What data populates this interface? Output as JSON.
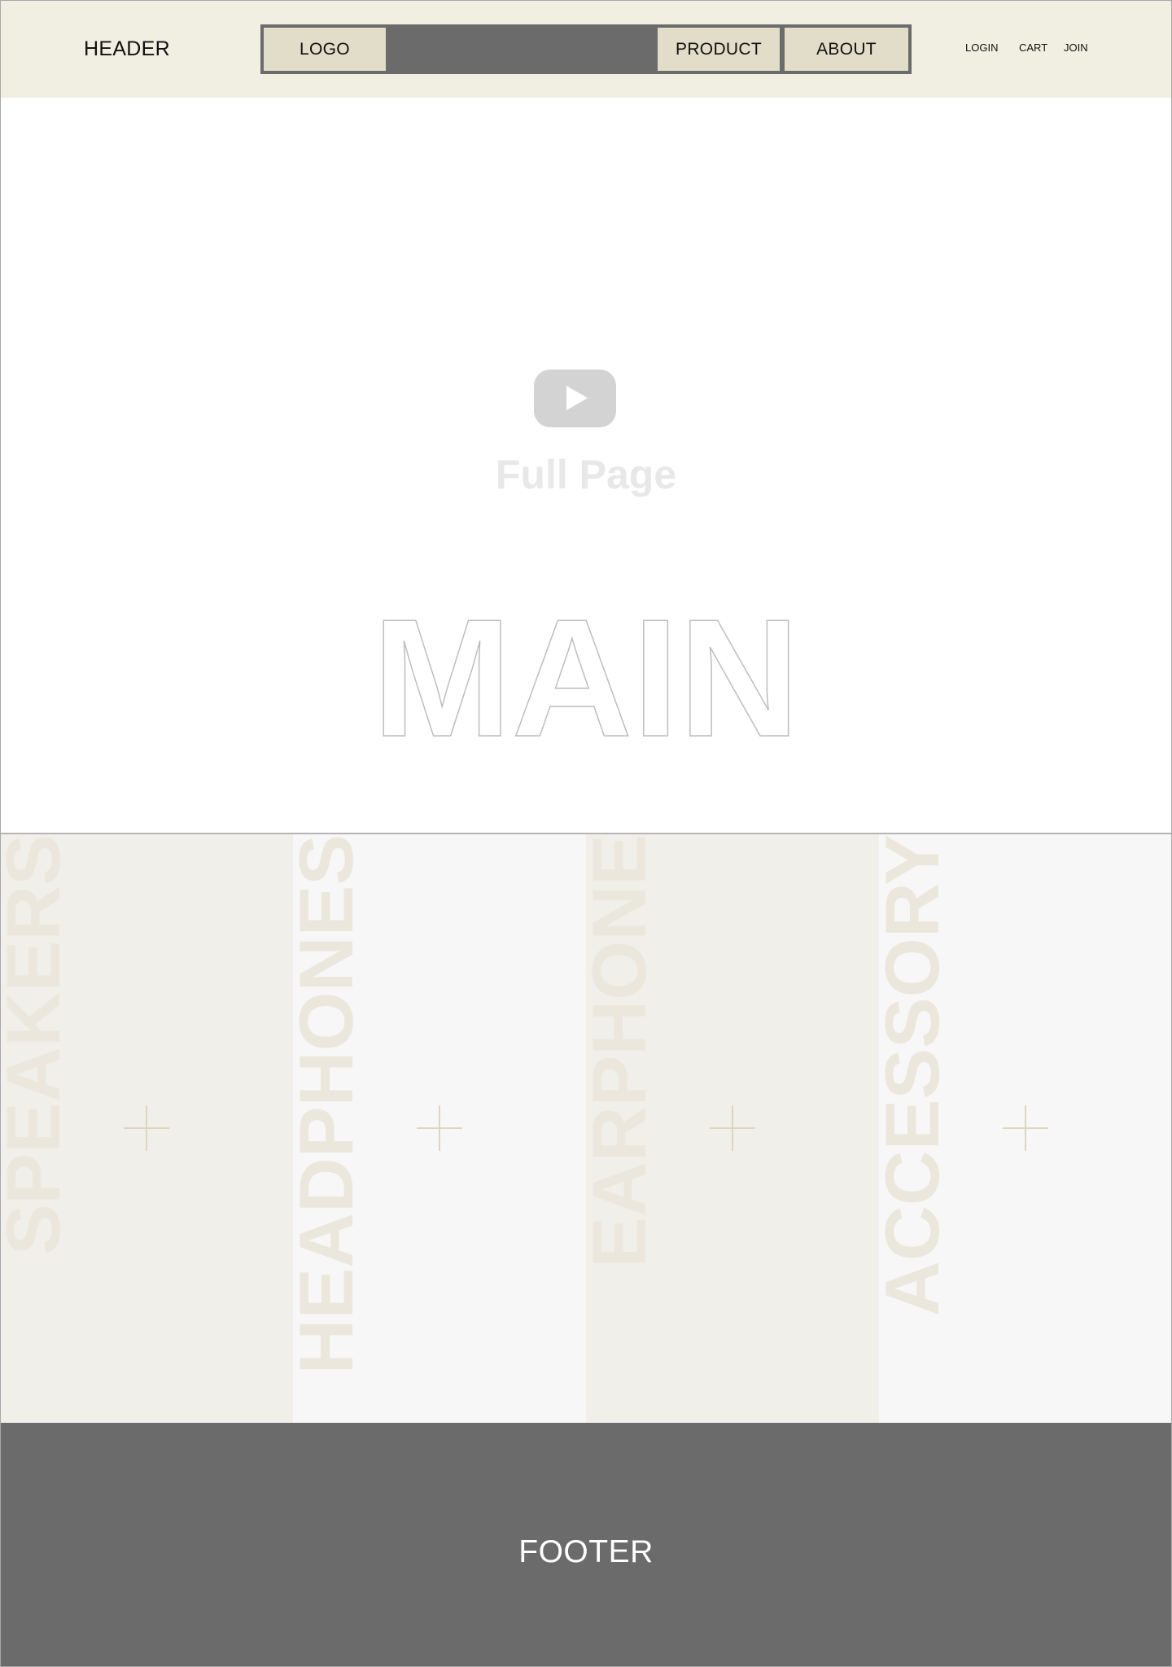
{
  "header": {
    "label": "HEADER",
    "nav": {
      "logo": "LOGO",
      "product": "PRODUCT",
      "about": "ABOUT"
    },
    "utility_links": [
      "LOGIN",
      "CART",
      "JOIN"
    ]
  },
  "main": {
    "video_icon": "play-icon",
    "video_caption": "Full Page",
    "title": "MAIN"
  },
  "categories": [
    {
      "label": "SPEAKERS",
      "icon": "plus-icon"
    },
    {
      "label": "HEADPHONES",
      "icon": "plus-icon"
    },
    {
      "label": "EARPHONE",
      "icon": "plus-icon"
    },
    {
      "label": "ACCESSORY",
      "icon": "plus-icon"
    }
  ],
  "footer": {
    "label": "FOOTER"
  },
  "colors": {
    "header_bg": "#f1eee2",
    "nav_box": "#e2ddc8",
    "nav_bar": "#6b6b6b",
    "footer_bg": "#6b6b6b",
    "panel_dark": "#f0efea",
    "panel_light": "#f7f7f7"
  }
}
